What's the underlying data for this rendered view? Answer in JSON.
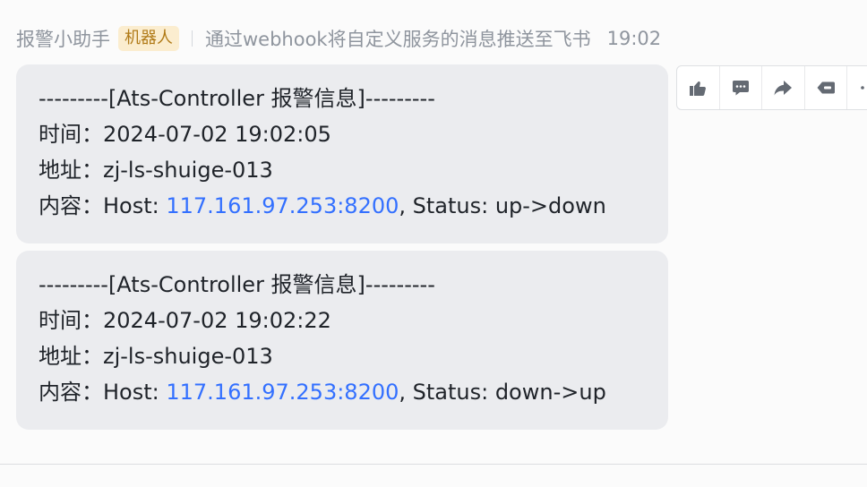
{
  "header": {
    "sender": "报警小助手",
    "badge": "机器人",
    "description": "通过webhook将自定义服务的消息推送至飞书",
    "time": "19:02"
  },
  "messages": [
    {
      "title": "---------[Ats-Controller 报警信息]---------",
      "time_label": "时间：",
      "time_value": "2024-07-02 19:02:05",
      "addr_label": "地址：",
      "addr_value": "zj-ls-shuige-013",
      "content_label": "内容：",
      "host_prefix": "Host: ",
      "host_link": "117.161.97.253:8200",
      "status_text": ", Status: up->down"
    },
    {
      "title": "---------[Ats-Controller 报警信息]---------",
      "time_label": "时间：",
      "time_value": "2024-07-02 19:02:22",
      "addr_label": "地址：",
      "addr_value": "zj-ls-shuige-013",
      "content_label": "内容：",
      "host_prefix": "Host: ",
      "host_link": "117.161.97.253:8200",
      "status_text": ", Status: down->up"
    }
  ],
  "toolbar": {
    "icons": [
      "thumbs-up-icon",
      "comment-icon",
      "forward-icon",
      "tag-icon",
      "more-icon"
    ],
    "icon_color": "#646a73"
  }
}
